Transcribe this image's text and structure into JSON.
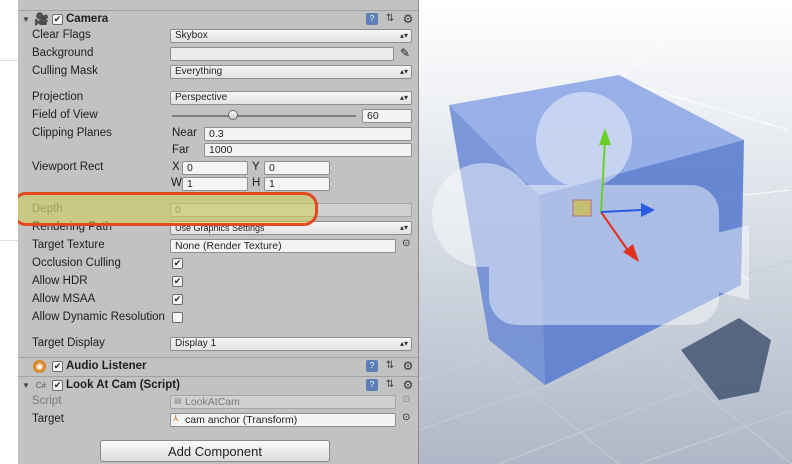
{
  "camera": {
    "title": "Camera",
    "clear_flags": {
      "label": "Clear Flags",
      "value": "Skybox"
    },
    "background": {
      "label": "Background"
    },
    "culling_mask": {
      "label": "Culling Mask",
      "value": "Everything"
    },
    "projection": {
      "label": "Projection",
      "value": "Perspective"
    },
    "fov": {
      "label": "Field of View",
      "value": "60",
      "slider_fraction": 0.33
    },
    "clipping": {
      "label": "Clipping Planes",
      "near_label": "Near",
      "near": "0.3",
      "far_label": "Far",
      "far": "1000"
    },
    "viewport": {
      "label": "Viewport Rect",
      "x_label": "X",
      "x": "0",
      "y_label": "Y",
      "y": "0",
      "w_label": "W",
      "w": "1",
      "h_label": "H",
      "h": "1"
    },
    "depth": {
      "label": "Depth",
      "value": "0"
    },
    "rendering_path": {
      "label": "Rendering Path",
      "value": "Use Graphics Settings"
    },
    "target_texture": {
      "label": "Target Texture",
      "value": "None (Render Texture)"
    },
    "occlusion_culling": {
      "label": "Occlusion Culling",
      "checked": true
    },
    "allow_hdr": {
      "label": "Allow HDR",
      "checked": true
    },
    "allow_msaa": {
      "label": "Allow MSAA",
      "checked": true
    },
    "allow_dynamic_resolution": {
      "label": "Allow Dynamic Resolution",
      "checked": false
    },
    "target_display": {
      "label": "Target Display",
      "value": "Display 1"
    }
  },
  "audio_listener": {
    "title": "Audio Listener"
  },
  "look_at_cam": {
    "title": "Look At Cam (Script)",
    "script": {
      "label": "Script",
      "value": "LookAtCam"
    },
    "target": {
      "label": "Target",
      "value": "cam anchor (Transform)"
    }
  },
  "add_component_label": "Add Component",
  "colors": {
    "inspector_bg": "#c2c2c2",
    "highlight_border": "#e34a22",
    "cube": "#7f9ce0",
    "scene_bg": "#b9c3d3"
  }
}
